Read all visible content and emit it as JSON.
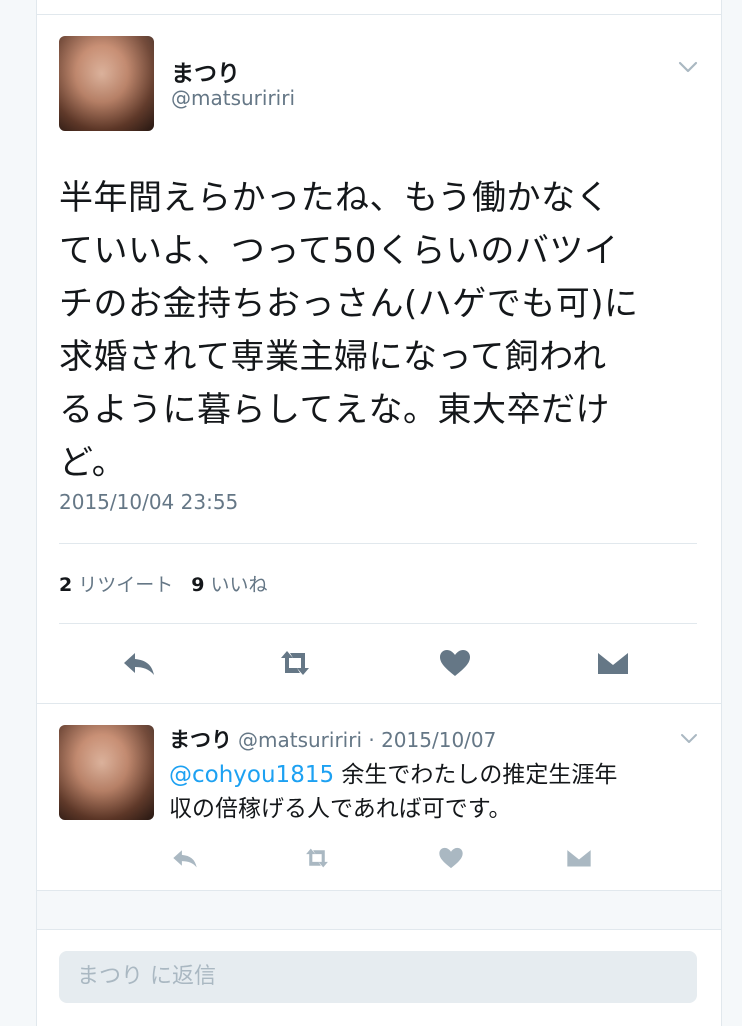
{
  "main_tweet": {
    "display_name": "まつり",
    "handle": "@matsuririri",
    "text_lines": [
      "半年間えらかったね、もう働かなく",
      "ていいよ、つって50くらいのバツイ",
      "チのお金持ちおっさん(ハゲでも可)に",
      "求婚されて専業主婦になって飼われ",
      "るように暮らしてえな。東大卒だけ",
      "ど。"
    ],
    "timestamp": "2015/10/04 23:55",
    "retweet_count": "2",
    "retweet_label": "リツイート",
    "like_count": "9",
    "like_label": "いいね"
  },
  "reply_tweet": {
    "display_name": "まつり",
    "meta": "@matsuririri · 2015/10/07",
    "mention": "@cohyou1815",
    "text_line1": " 余生でわたしの推定生涯年",
    "text_line2": "収の倍稼げる人であれば可です。"
  },
  "reply_box": {
    "placeholder": "まつり に返信"
  },
  "icons": {
    "reply": "reply-icon",
    "retweet": "retweet-icon",
    "like": "heart-icon",
    "dm": "envelope-icon",
    "more": "chevron-down-icon"
  },
  "colors": {
    "text": "#14171a",
    "secondary": "#657786",
    "link": "#1da1f2",
    "icon_dark": "#657786",
    "icon_light": "#aab8c2"
  }
}
